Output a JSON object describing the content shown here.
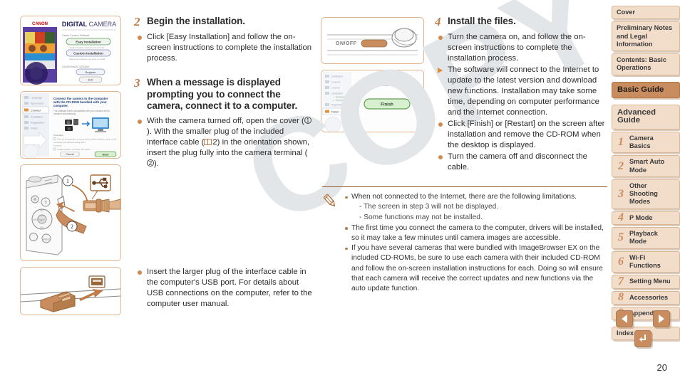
{
  "page": {
    "number": "20",
    "watermark": "COPY"
  },
  "steps": {
    "step2": {
      "num": "2",
      "title": "Begin the installation.",
      "bullets": [
        {
          "type": "dot",
          "text": "Click [Easy Installation] and follow the on-screen instructions to complete the installation process."
        }
      ]
    },
    "step3": {
      "num": "3",
      "title": "When a message is displayed prompting you to connect the camera, connect it to a computer.",
      "bullet1_pre": "With the camera turned off, open the cover (",
      "bullet1_c1": "1",
      "bullet1_mid": "). With the smaller plug of the included interface cable (",
      "bullet1_ref": "2",
      "bullet1_mid2": ") in the orientation shown, insert the plug fully into the camera terminal (",
      "bullet1_c2": "2",
      "bullet1_post": ").",
      "bullet2": "Insert the larger plug of the interface cable in the computer's USB port. For details about USB connections on the computer, refer to the computer user manual."
    },
    "step4": {
      "num": "4",
      "title": "Install the files.",
      "bullets": [
        {
          "type": "dot",
          "text": "Turn the camera on, and follow the on-screen instructions to complete the installation process."
        },
        {
          "type": "triangle",
          "text": "The software will connect to the Internet to update to the latest version and download new functions. Installation may take some time, depending on computer performance and the Internet connection."
        },
        {
          "type": "dot",
          "text": "Click [Finish] or [Restart] on the screen after installation and remove the CD-ROM when the desktop is displayed."
        },
        {
          "type": "dot",
          "text": "Turn the camera off and disconnect the cable."
        }
      ]
    }
  },
  "note": {
    "items": [
      {
        "text": "When not connected to the Internet, there are the following limitations.",
        "subs": [
          "- The screen in step 3 will not be displayed.",
          "- Some functions may not be installed."
        ]
      },
      {
        "text": "The first time you connect the camera to the computer, drivers will be installed, so it may take a few minutes until camera images are accessible.",
        "subs": []
      },
      {
        "text": "If you have several cameras that were bundled with ImageBrowser EX on the included CD-ROMs, be sure to use each camera with their included CD-ROM and follow the on-screen installation instructions for each. Doing so will ensure that each camera will receive the correct updates and new functions via the auto update function.",
        "subs": []
      }
    ]
  },
  "sidebar": {
    "items": [
      {
        "label": "Cover",
        "num": "",
        "active": false,
        "big": false
      },
      {
        "label": "Preliminary Notes and Legal Information",
        "num": "",
        "active": false,
        "big": false
      },
      {
        "label": "Contents: Basic Operations",
        "num": "",
        "active": false,
        "big": false
      },
      {
        "label": "Basic Guide",
        "num": "",
        "active": true,
        "big": true
      },
      {
        "label": "Advanced Guide",
        "num": "",
        "active": false,
        "big": true
      },
      {
        "label": "Camera Basics",
        "num": "1",
        "active": false,
        "big": false
      },
      {
        "label": "Smart Auto Mode",
        "num": "2",
        "active": false,
        "big": false
      },
      {
        "label": "Other Shooting Modes",
        "num": "3",
        "active": false,
        "big": false
      },
      {
        "label": "P Mode",
        "num": "4",
        "active": false,
        "big": false
      },
      {
        "label": "Playback Mode",
        "num": "5",
        "active": false,
        "big": false
      },
      {
        "label": "Wi-Fi Functions",
        "num": "6",
        "active": false,
        "big": false
      },
      {
        "label": "Setting Menu",
        "num": "7",
        "active": false,
        "big": false
      },
      {
        "label": "Accessories",
        "num": "8",
        "active": false,
        "big": false
      },
      {
        "label": "Appendix",
        "num": "9",
        "active": false,
        "big": false
      },
      {
        "label": "Index",
        "num": "",
        "active": false,
        "big": false
      }
    ]
  },
  "nav_buttons": {
    "prev": "previous-page",
    "next": "next-page",
    "back": "back"
  },
  "figures": {
    "installer_screen": {
      "brand": "CANON",
      "title_bold": "DIGITAL",
      "title_light": "CAMERA",
      "section1": "Canon Camera Software",
      "btn_easy": "Easy Installation",
      "cap_easy": "Install standard software components",
      "btn_custom": "Custom Installation",
      "cap_custom": "Select the software that you want to install",
      "section2": "CANON IMAGE GATEWAY",
      "btn_register": "Register",
      "btn_exit": "Exit"
    },
    "connect_screen": {
      "heading": "Connect the camera to the computer with the CD-ROM bundled with your computer.",
      "sub": "The software that is compatible with your camera will be installed automatically.",
      "btn_cancel": "Cancel",
      "btn_next": "Next"
    },
    "camera_cable": {
      "callout1": "1",
      "callout2": "2",
      "usb_label": "USB"
    },
    "usb_plug": {
      "label": "USB plug into computer port"
    },
    "camera_power": {
      "label": "ON/OFF"
    },
    "finish_screen": {
      "heading": "Installation of the software has been completed",
      "btn_finish": "Finish"
    }
  }
}
